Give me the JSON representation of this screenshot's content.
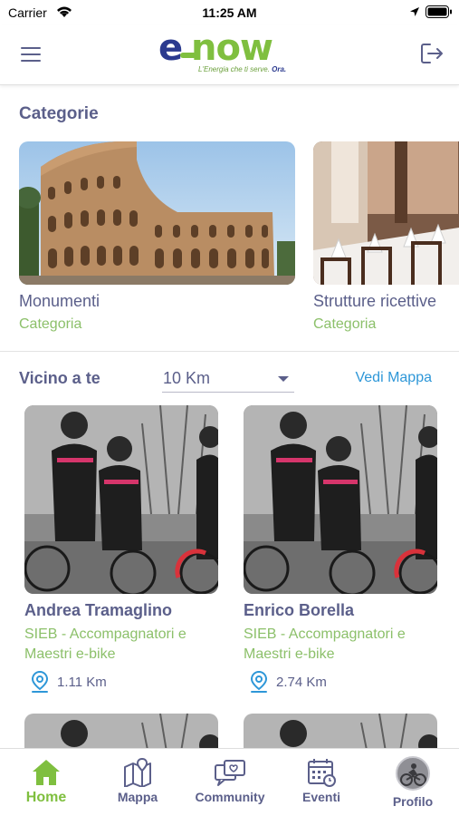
{
  "status_bar": {
    "carrier": "Carrier",
    "time": "11:25 AM"
  },
  "header": {
    "logo_e": "e",
    "logo_now": "now",
    "tagline_main": "L'Energia che ti serve.",
    "tagline_bold": "Ora."
  },
  "categories_section": {
    "title": "Categorie",
    "items": [
      {
        "name": "Monumenti",
        "subtitle": "Categoria"
      },
      {
        "name": "Strutture ricettive",
        "subtitle": "Categoria"
      }
    ]
  },
  "nearby_section": {
    "title": "Vicino a te",
    "distance_value": "10 Km",
    "map_link": "Vedi Mappa",
    "items": [
      {
        "name": "Andrea Tramaglino",
        "category": "SIEB - Accompagnatori e Maestri e-bike",
        "distance": "1.11 Km"
      },
      {
        "name": "Enrico Borella",
        "category": "SIEB - Accompagnatori e Maestri e-bike",
        "distance": "2.74 Km"
      }
    ]
  },
  "tab_bar": {
    "tabs": [
      {
        "label": "Home",
        "icon": "home-icon",
        "active": true
      },
      {
        "label": "Mappa",
        "icon": "map-icon",
        "active": false
      },
      {
        "label": "Community",
        "icon": "community-icon",
        "active": false
      },
      {
        "label": "Eventi",
        "icon": "calendar-icon",
        "active": false
      },
      {
        "label": "Profilo",
        "icon": "avatar",
        "active": false
      }
    ]
  },
  "colors": {
    "primary_text": "#5b5f8a",
    "accent_green": "#7fbf3f",
    "subtitle_green": "#8cc06a",
    "link_blue": "#2e97d8",
    "brand_blue": "#2b3a8f"
  }
}
